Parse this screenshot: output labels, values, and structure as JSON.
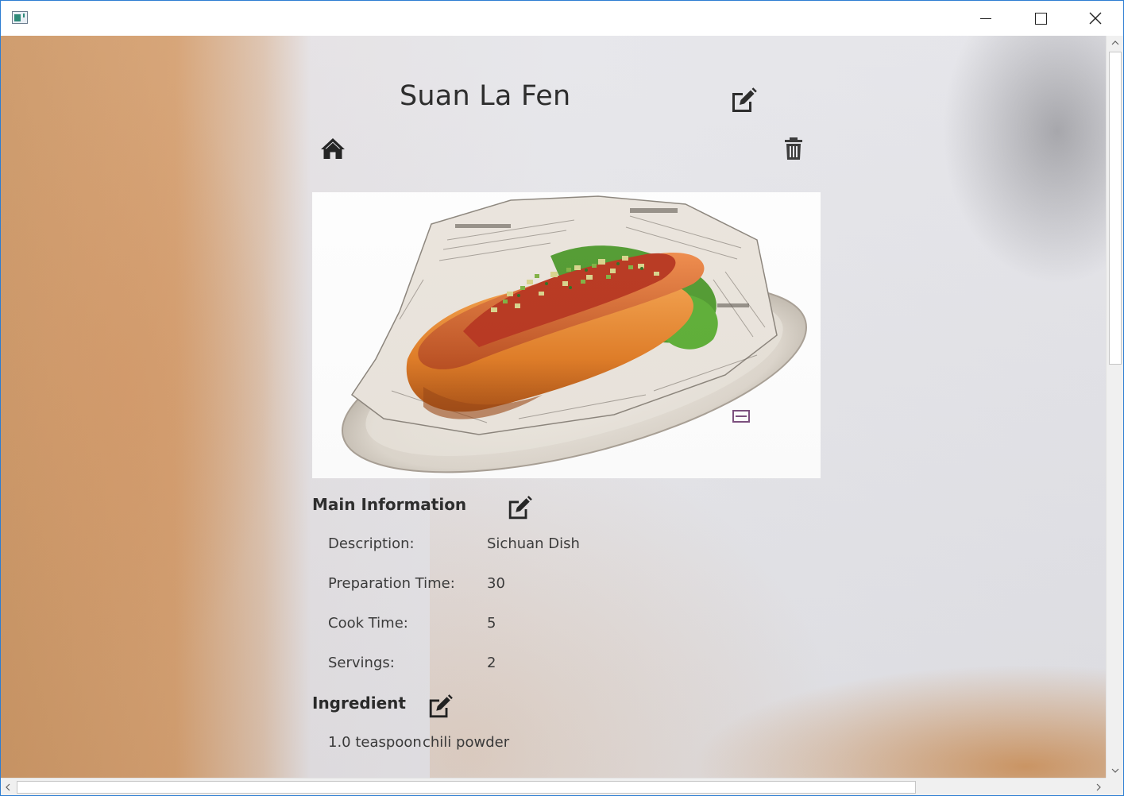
{
  "window": {
    "title": "",
    "controls": {
      "minimize": "minimize",
      "maximize": "maximize",
      "close": "close"
    }
  },
  "recipe": {
    "title": "Suan La Fen",
    "image_alt": "hot dog with relish on newspaper-lined plate"
  },
  "main_information": {
    "heading": "Main Information",
    "fields": [
      {
        "label": "Description:",
        "value": "Sichuan Dish"
      },
      {
        "label": "Preparation Time:",
        "value": "30"
      },
      {
        "label": "Cook Time:",
        "value": "5"
      },
      {
        "label": "Servings:",
        "value": "2"
      }
    ]
  },
  "ingredients": {
    "heading": "Ingredient",
    "items": [
      {
        "quantity": "1.0 teaspoon",
        "name": "chili powder"
      }
    ]
  },
  "icons": {
    "edit": "edit-icon",
    "home": "home-icon",
    "delete": "trash-icon"
  },
  "colors": {
    "window_border": "#2d7dd2",
    "text": "#222222",
    "icon": "#222222",
    "background_light": "#e6e6ea",
    "background_warm": "#d5a071"
  }
}
